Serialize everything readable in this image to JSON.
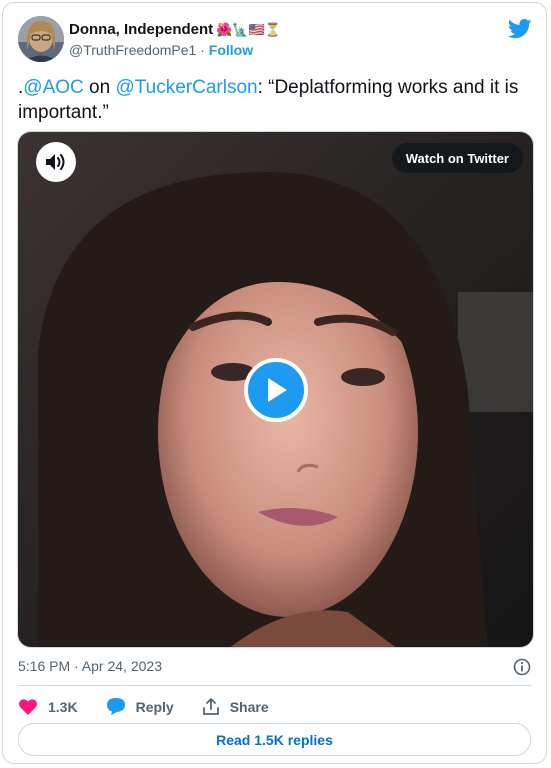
{
  "tweet": {
    "author_name": "Donna, Independent",
    "author_emojis": "🌺🗽🇺🇸⏳",
    "author_handle": "@TruthFreedomPe1",
    "separator": "·",
    "follow_label": "Follow",
    "text_prefix": ".",
    "mention_1": "@AOC",
    "text_mid": " on ",
    "mention_2": "@TuckerCarlson",
    "text_quote": ": “Deplatforming works and it is important.”",
    "timestamp": "5:16 PM · Apr 24, 2023"
  },
  "media": {
    "watch_label": "Watch on Twitter"
  },
  "actions": {
    "likes": "1.3K",
    "reply_label": "Reply",
    "share_label": "Share",
    "read_replies_label": "Read 1.5K replies"
  },
  "colors": {
    "accent": "#1d9bf0",
    "like": "#f91880",
    "muted": "#536471"
  },
  "icons": {
    "brand": "twitter-bird-icon",
    "sound": "speaker-icon",
    "play": "play-icon",
    "info": "info-icon",
    "like": "heart-icon",
    "reply": "reply-bubble-icon",
    "share": "share-icon"
  }
}
